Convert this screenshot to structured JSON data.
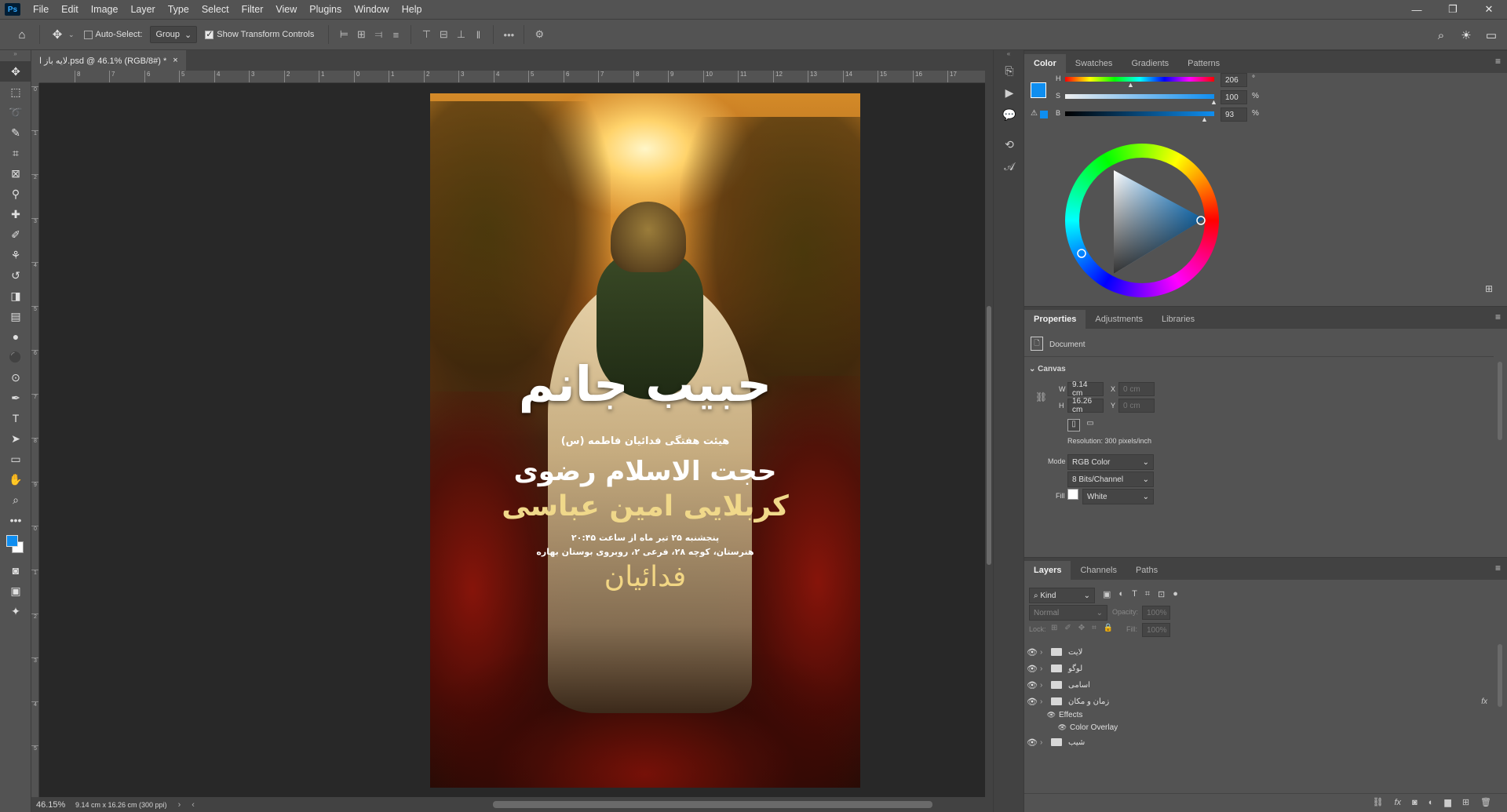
{
  "menu": {
    "app_icon": "Ps",
    "items": [
      "File",
      "Edit",
      "Image",
      "Layer",
      "Type",
      "Select",
      "Filter",
      "View",
      "Plugins",
      "Window",
      "Help"
    ]
  },
  "options": {
    "auto_select_label": "Auto-Select:",
    "auto_select_value": "Group",
    "show_transform_label": "Show Transform Controls",
    "more_icon": "•••"
  },
  "document": {
    "tab_title": "لایه باز ا.psd @ 46.1% (RGB/8#) *",
    "zoom": "46.15%",
    "doc_size": "9.14 cm x 16.26 cm (300 ppi)",
    "ruler_h": [
      "8",
      "7",
      "6",
      "5",
      "4",
      "3",
      "2",
      "1",
      "0",
      "1",
      "2",
      "3",
      "4",
      "5",
      "6",
      "7",
      "8",
      "9",
      "10",
      "11",
      "12",
      "13",
      "14",
      "15",
      "16",
      "17"
    ],
    "ruler_v": [
      "0",
      "1",
      "2",
      "3",
      "4",
      "5",
      "6",
      "7",
      "8",
      "9",
      "0",
      "1",
      "2",
      "3",
      "4",
      "5"
    ]
  },
  "poster": {
    "title": "حبیب جانم",
    "subtitle": "هیئت هفتگی فدائیان فاطمه (س)",
    "speaker": "حجت الاسلام رضوی",
    "performer": "کربلایی امین عباسی",
    "date_line": "پنجشنبه ۲۵ تیر ماه از ساعت ۲۰:۴۵",
    "address_line": "هنرستان، کوچه ۲۸، فرعی ۲، روبروی بوستان بهاره",
    "logo_text": "فدائیان"
  },
  "color_panel": {
    "tabs": [
      "Color",
      "Swatches",
      "Gradients",
      "Patterns"
    ],
    "h_label": "H",
    "h_value": "206",
    "h_unit": "°",
    "s_label": "S",
    "s_value": "100",
    "s_unit": "%",
    "b_label": "B",
    "b_value": "93",
    "b_unit": "%",
    "fg_color": "#0f8ef0",
    "bg_color": "#ffffff"
  },
  "properties_panel": {
    "tabs": [
      "Properties",
      "Adjustments",
      "Libraries"
    ],
    "doc_label": "Document",
    "section": "Canvas",
    "w_label": "W",
    "w_value": "9.14 cm",
    "h_label": "H",
    "h_value": "16.26 cm",
    "x_label": "X",
    "x_value": "0 cm",
    "y_label": "Y",
    "y_value": "0 cm",
    "resolution": "Resolution: 300 pixels/inch",
    "mode_label": "Mode",
    "mode_value": "RGB Color",
    "bits_value": "8 Bits/Channel",
    "fill_label": "Fill",
    "fill_value": "White"
  },
  "layers_panel": {
    "tabs": [
      "Layers",
      "Channels",
      "Paths"
    ],
    "filter_kind": "Kind",
    "blend_mode": "Normal",
    "opacity_label": "Opacity:",
    "opacity_value": "100%",
    "lock_label": "Lock:",
    "fill_label": "Fill:",
    "fill_value": "100%",
    "layers": [
      {
        "name": "لایت",
        "type": "group"
      },
      {
        "name": "لوگو",
        "type": "group"
      },
      {
        "name": "اسامی",
        "type": "group"
      },
      {
        "name": "زمان و مکان",
        "type": "group",
        "fx": "fx"
      },
      {
        "name": "Effects",
        "type": "effects"
      },
      {
        "name": "Color Overlay",
        "type": "effect"
      },
      {
        "name": "شیب",
        "type": "group"
      }
    ]
  }
}
